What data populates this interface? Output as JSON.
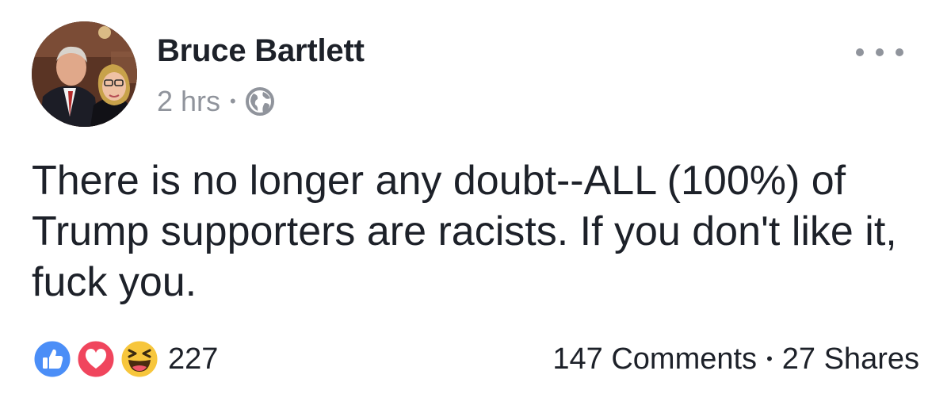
{
  "post": {
    "author": "Bruce Bartlett",
    "timestamp": "2 hrs",
    "separator": "•",
    "privacy_icon": "globe-icon",
    "text": "There is no longer any doubt--ALL (100%) of Trump supporters are racists. If you don't like it, fuck you.",
    "more_icon": "more-options-icon"
  },
  "footer": {
    "reactions": [
      "like-icon",
      "love-icon",
      "haha-icon"
    ],
    "reaction_count": "227",
    "comments": "147 Comments",
    "separator": "•",
    "shares": "27 Shares"
  },
  "colors": {
    "like": "#4b8ef7",
    "love": "#f0455d",
    "haha": "#f7c63c",
    "text": "#1d2129",
    "meta": "#90949c"
  }
}
